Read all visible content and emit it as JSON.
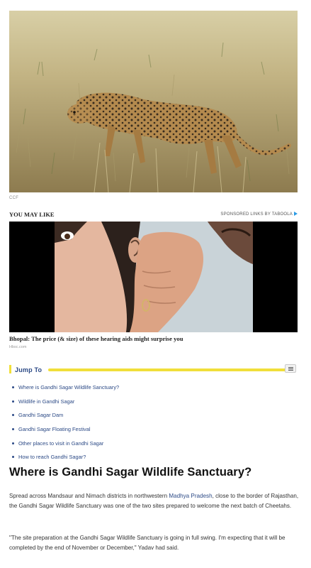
{
  "hero": {
    "alt": "Cheetah walking through grassland",
    "credit": "CCF"
  },
  "you_may_like": {
    "title": "YOU MAY LIKE",
    "sponsored": "SPONSORED LINKS BY TABOOLA",
    "ad": {
      "headline": "Bhopal: The price (& size) of these hearing aids might surprise you",
      "source": "Hbsc.com"
    }
  },
  "jump_to": {
    "title": "Jump To",
    "items": [
      "Where is Gandhi Sagar Wildlife Sanctuary?",
      "Wildlife in Gandhi Sagar",
      "Gandhi Sagar Dam",
      "Gandhi Sagar Floating Festival",
      "Other places to visit in Gandhi Sagar",
      "How to reach Gandhi Sagar?"
    ]
  },
  "article": {
    "heading": "Where is Gandhi Sagar Wildlife Sanctuary?",
    "p1_before": "Spread across Mandsaur and Nimach districts in northwestern ",
    "p1_link": "Madhya Pradesh",
    "p1_after": ", close to the border of Rajasthan, the Gandhi Sagar Wildlife Sanctuary was one of the two sites prepared to welcome the next batch of Cheetahs.",
    "p2": "\"The site preparation at the Gandhi Sagar Wildlife Sanctuary is going in full swing. I'm expecting that it will be completed by the end of November or December,\" Yadav had said."
  },
  "colors": {
    "accent_yellow": "#f1df3a",
    "link_blue": "#2c4a86",
    "taboola_blue": "#2b9be5"
  }
}
